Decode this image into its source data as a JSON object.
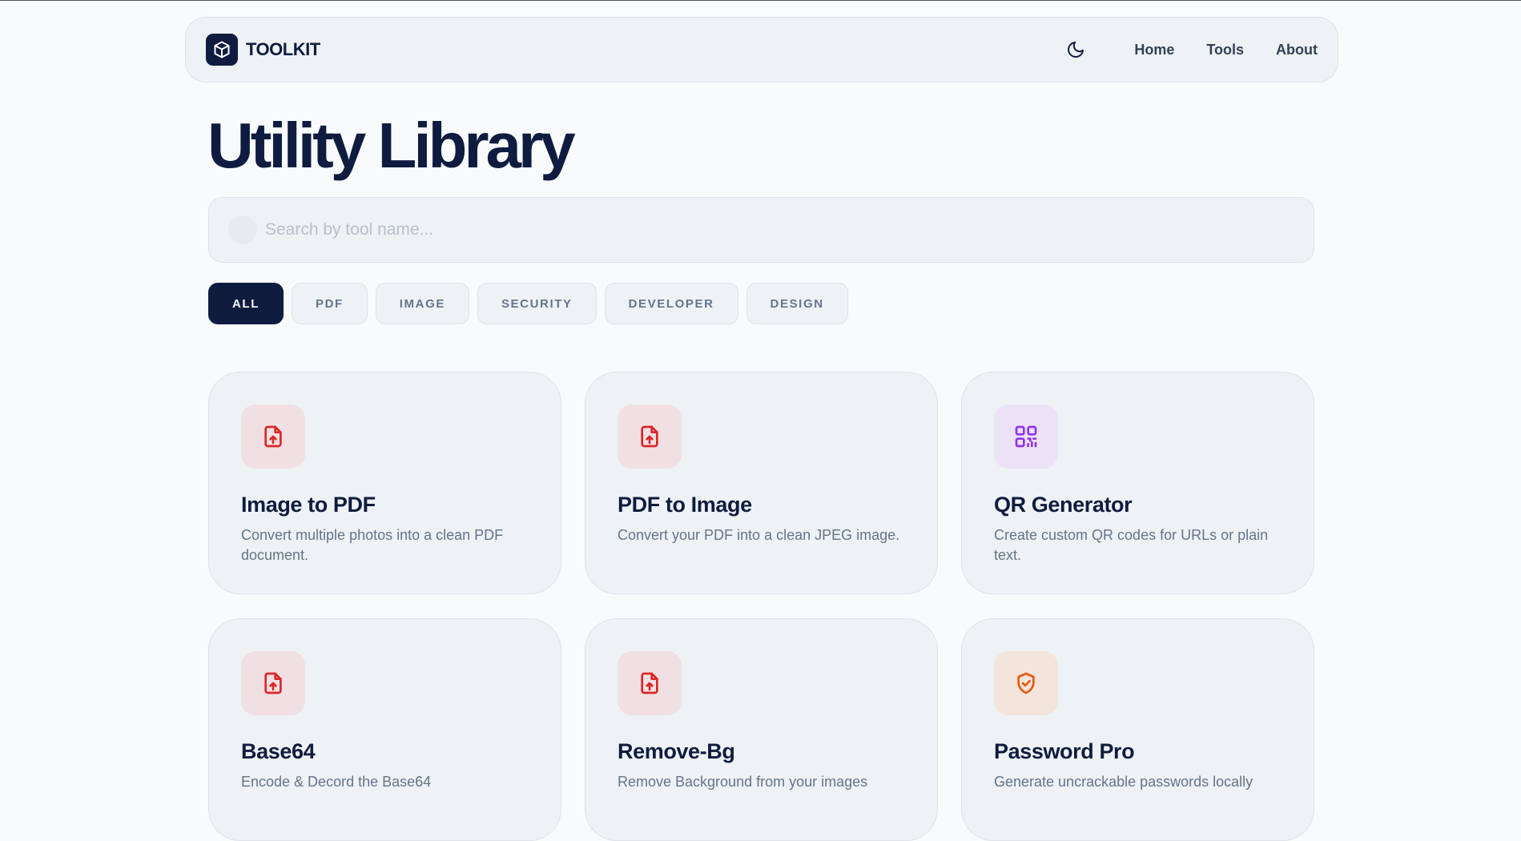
{
  "brand": {
    "name": "TOOLKIT"
  },
  "nav": {
    "theme_toggle_icon": "moon-icon",
    "links": [
      "Home",
      "Tools",
      "About"
    ]
  },
  "page": {
    "title": "Utility Library"
  },
  "search": {
    "placeholder": "Search by tool name..."
  },
  "filters": {
    "active": "ALL",
    "items": [
      "ALL",
      "PDF",
      "IMAGE",
      "SECURITY",
      "DEVELOPER",
      "DESIGN"
    ]
  },
  "tools": [
    {
      "title": "Image to PDF",
      "description": "Convert multiple photos into a clean PDF document.",
      "icon": "file-upload-icon",
      "icon_color": "#dc2626",
      "icon_bg": "#f1e0e3"
    },
    {
      "title": "PDF to Image",
      "description": "Convert your PDF into a clean JPEG image.",
      "icon": "file-upload-icon",
      "icon_color": "#dc2626",
      "icon_bg": "#f1e0e3"
    },
    {
      "title": "QR Generator",
      "description": "Create custom QR codes for URLs or plain text.",
      "icon": "qr-code-icon",
      "icon_color": "#9333ea",
      "icon_bg": "#ebe2f6"
    },
    {
      "title": "Base64",
      "description": "Encode & Decord the Base64",
      "icon": "file-upload-icon",
      "icon_color": "#dc2626",
      "icon_bg": "#f1e0e3"
    },
    {
      "title": "Remove-Bg",
      "description": "Remove Background from your images",
      "icon": "file-upload-icon",
      "icon_color": "#dc2626",
      "icon_bg": "#f1e0e3"
    },
    {
      "title": "Password Pro",
      "description": "Generate uncrackable passwords locally",
      "icon": "shield-check-icon",
      "icon_color": "#ea580c",
      "icon_bg": "#f3e5dc"
    }
  ]
}
